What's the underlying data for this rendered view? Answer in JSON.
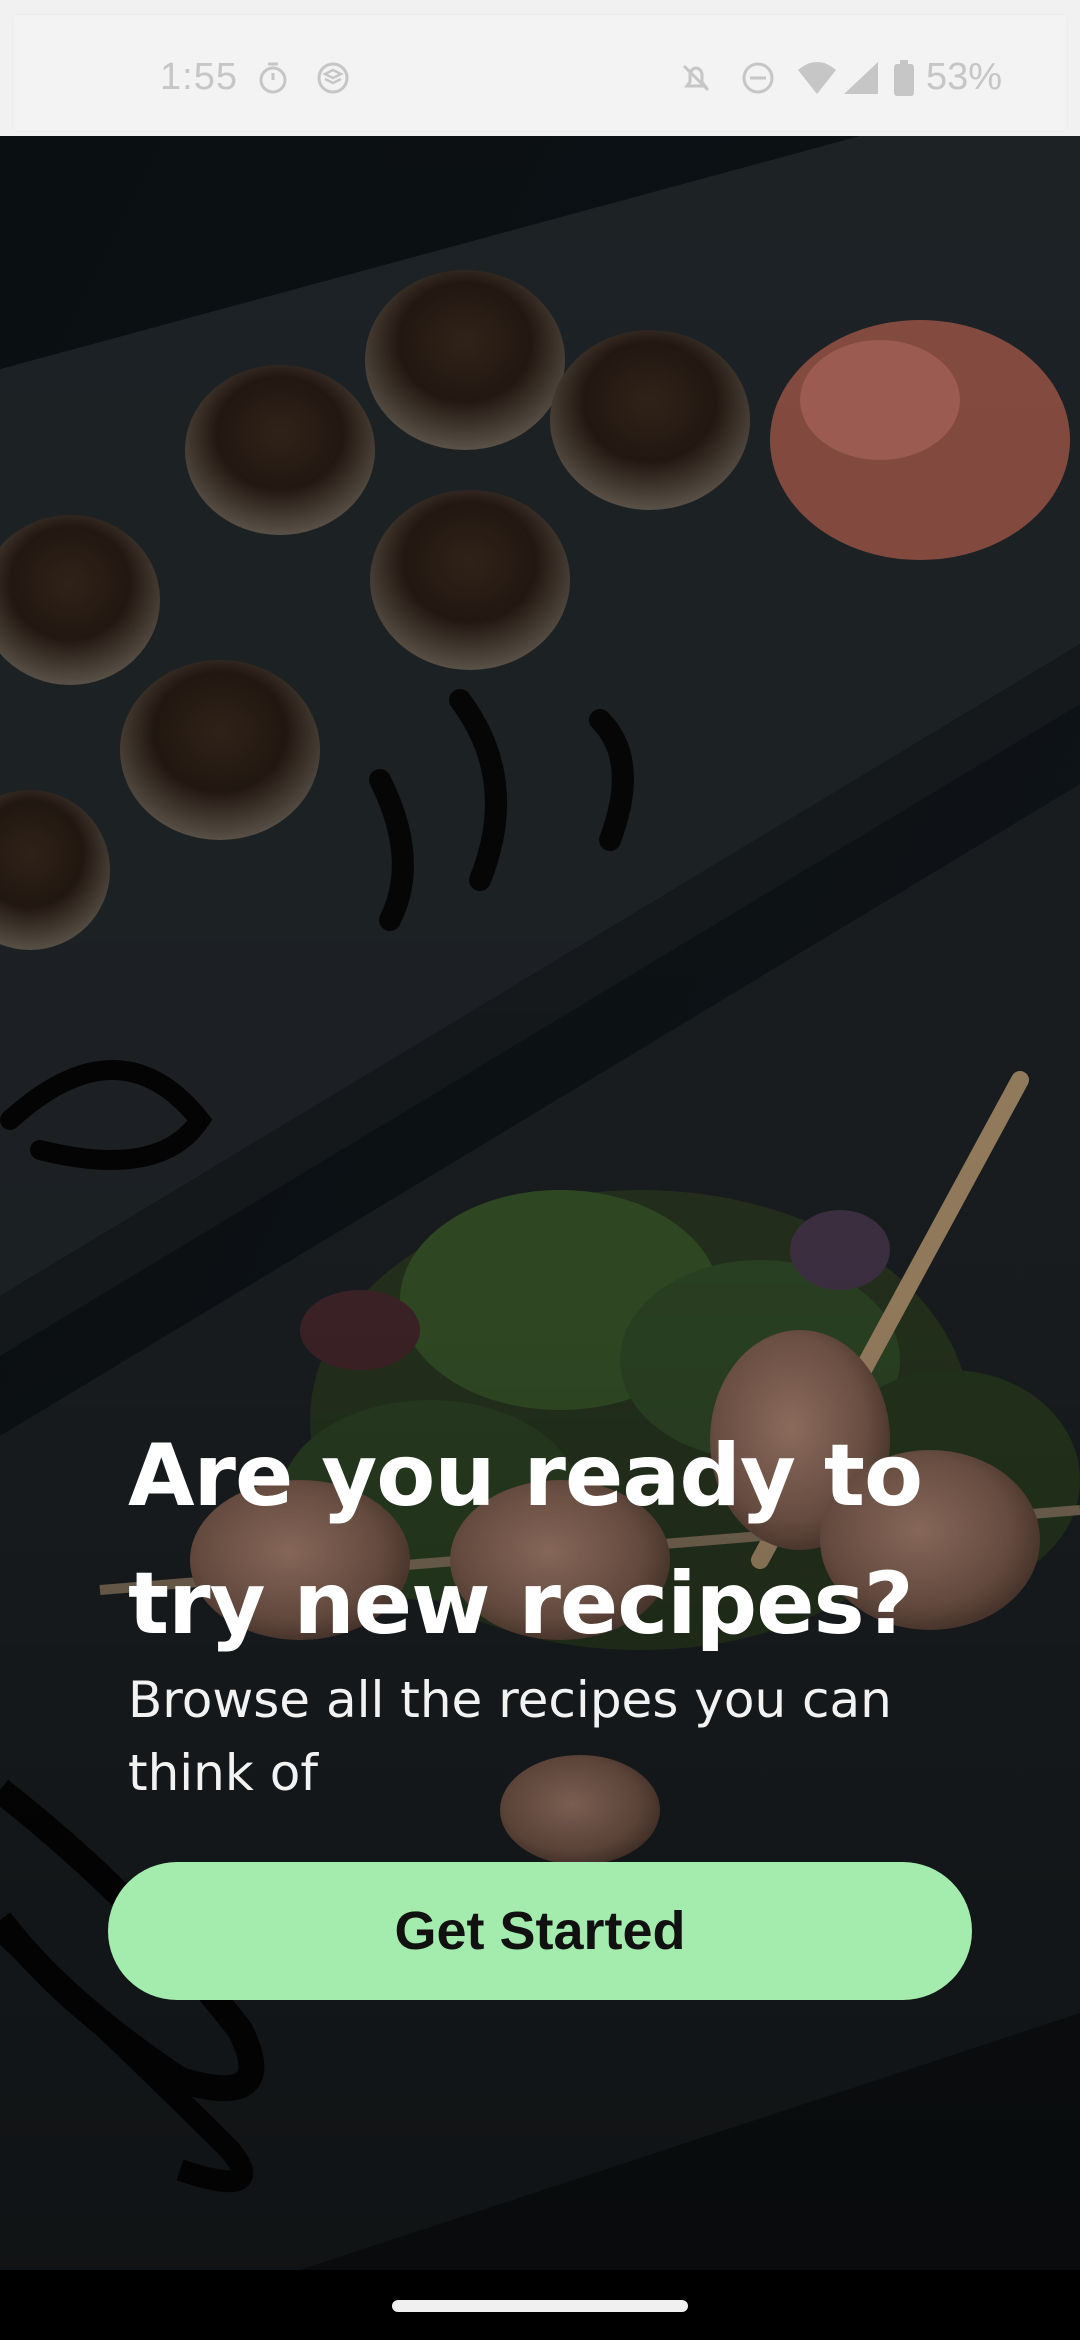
{
  "status_bar": {
    "time": "1:55",
    "battery_percent": "53%",
    "icons": [
      "timer-icon",
      "stack-icon",
      "bell-off-icon",
      "do-not-disturb-icon",
      "wifi-icon",
      "signal-icon",
      "battery-icon"
    ]
  },
  "hero": {
    "photo": "food-photo",
    "headline": "Are you ready to try new recipes?",
    "subtitle": "Browse all the recipes you can think of"
  },
  "actions": {
    "get_started_label": "Get Started"
  },
  "colors": {
    "button_bg": "#a3ecad",
    "button_text": "#111111",
    "headline_text": "#ffffff",
    "status_bar_bg": "#f1f1f1"
  }
}
